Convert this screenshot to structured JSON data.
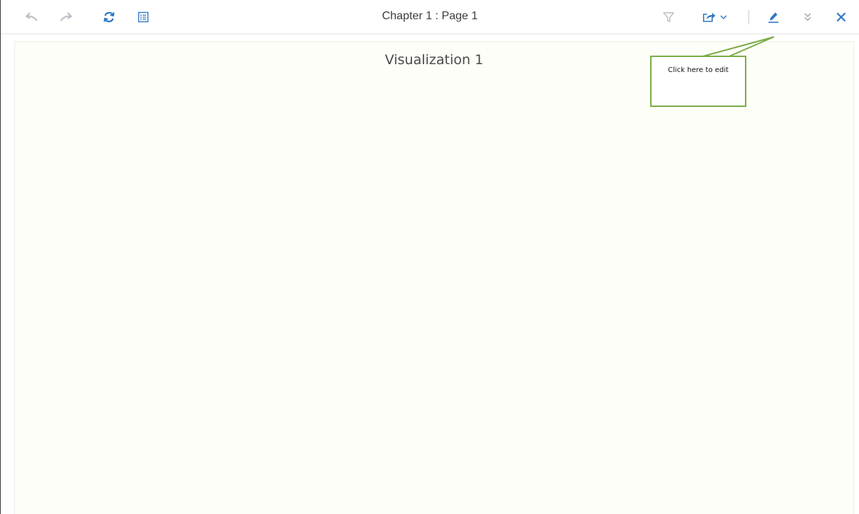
{
  "toolbar": {
    "page_title": "Chapter 1 : Page 1",
    "icons": {
      "undo": "undo-arrow-icon",
      "redo": "redo-arrow-icon",
      "refresh": "refresh-icon",
      "outline": "list-icon",
      "filter": "filter-funnel-icon",
      "share": "share-export-icon",
      "edit": "pencil-icon",
      "collapse": "double-chevron-down-icon",
      "close": "close-x-icon"
    },
    "colors": {
      "disabled": "#b9c0c7",
      "accent": "#2f77c7"
    }
  },
  "canvas": {
    "visualization_title": "Visualization 1"
  },
  "callout": {
    "text": "Click here to edit",
    "border_color": "#7aac47"
  }
}
